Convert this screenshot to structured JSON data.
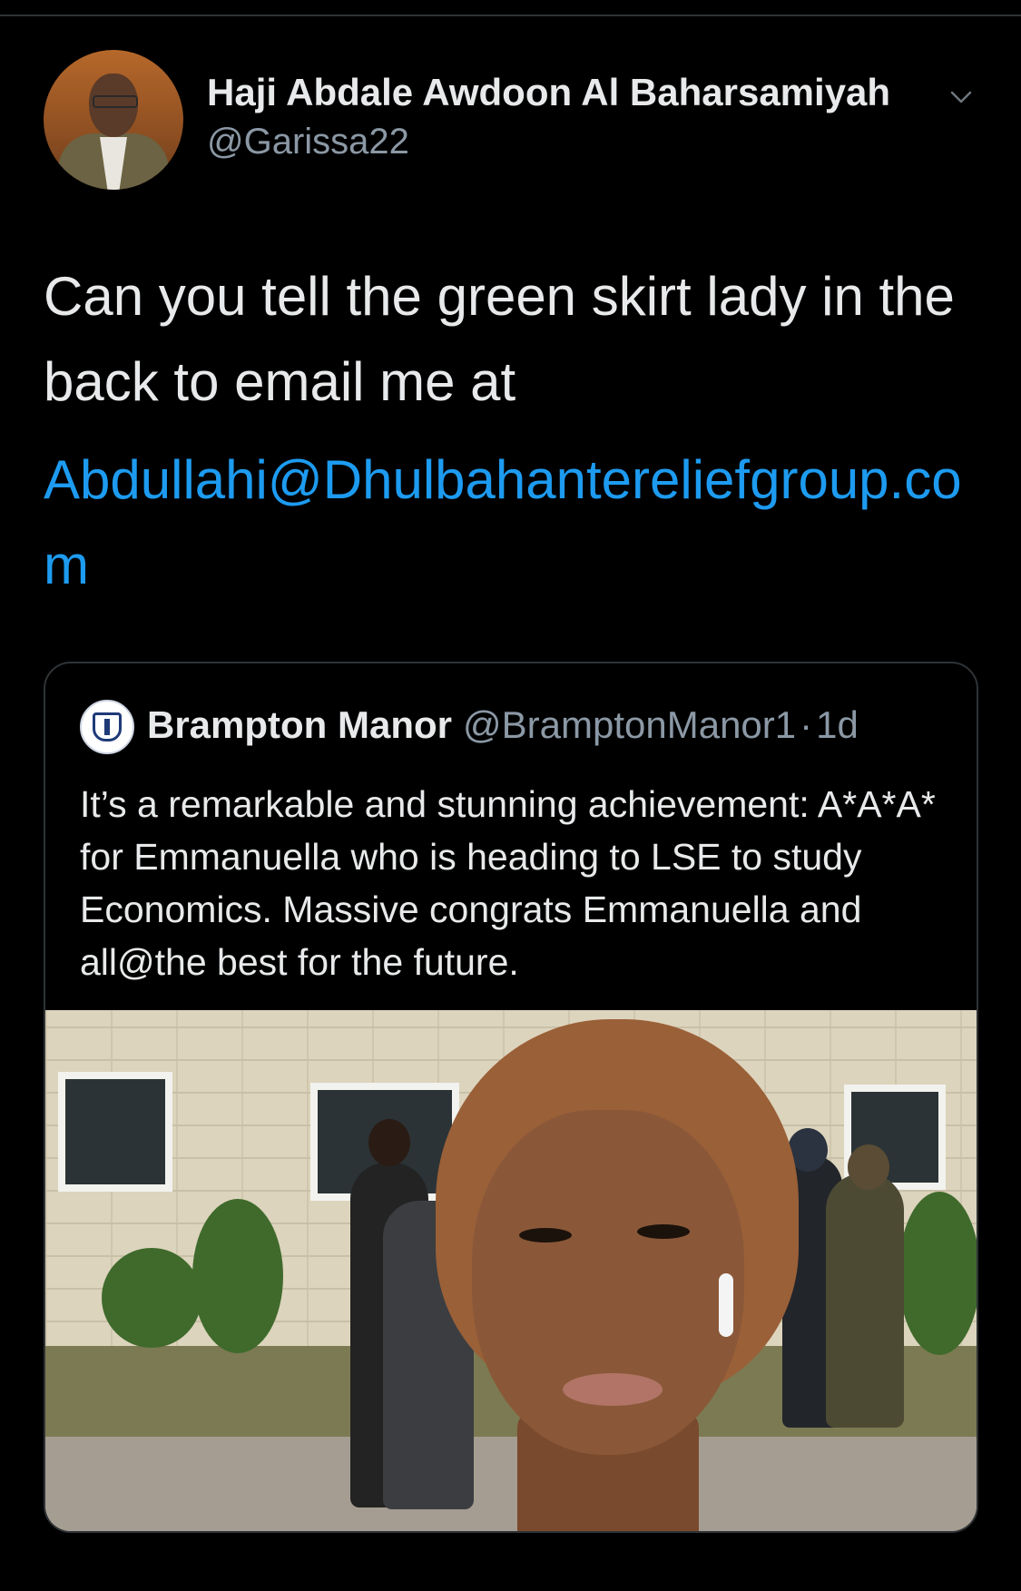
{
  "author": {
    "display_name": "Haji Abdale Awdoon Al Baharsamiyah",
    "handle": "@Garissa22"
  },
  "tweet": {
    "text": "Can you tell the green skirt lady in the back to email me at",
    "link": "Abdullahi@Dhulbahantereliefgroup.com"
  },
  "quoted": {
    "display_name": "Brampton Manor",
    "handle": "@BramptonManor1",
    "separator": "·",
    "time": "1d",
    "text": "It’s a remarkable and stunning achievement: A*A*A* for Emmanuella who is heading to LSE to study Economics. Massive congrats Emmanuella and all@the best for the future."
  },
  "icons": {
    "menu": "chevron-down-icon",
    "avatar": "profile-photo",
    "quoted_avatar": "school-crest"
  },
  "colors": {
    "background": "#000000",
    "link": "#1d9bf0",
    "secondary_text": "#8b98a5",
    "border": "#2f3336"
  }
}
